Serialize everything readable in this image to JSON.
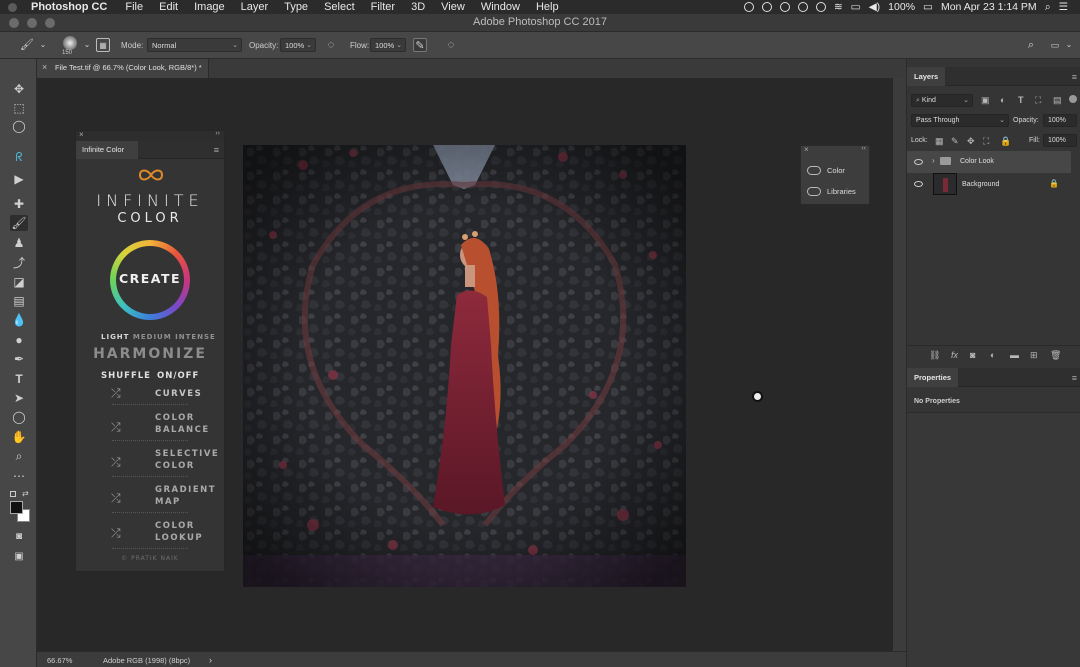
{
  "menubar": {
    "app_name": "Photoshop CC",
    "items": [
      "File",
      "Edit",
      "Image",
      "Layer",
      "Type",
      "Select",
      "Filter",
      "3D",
      "View",
      "Window",
      "Help"
    ],
    "battery": "100%",
    "clock": "Mon Apr 23  1:14 PM"
  },
  "titlebar": {
    "title": "Adobe Photoshop CC 2017"
  },
  "options": {
    "brush_size": "150",
    "mode_label": "Mode:",
    "mode_value": "Normal",
    "opacity_label": "Opacity:",
    "opacity_value": "100%",
    "flow_label": "Flow:",
    "flow_value": "100%"
  },
  "document": {
    "tab_title": "File Test.tif @ 66.7% (Color Look, RGB/8*) *",
    "zoom": "66.67%",
    "profile": "Adobe RGB (1998) (8bpc)"
  },
  "infinite_color": {
    "tab_label": "Infinite Color",
    "logo_line1": "INFINITE",
    "logo_line2": "COLOR",
    "create_label": "CREATE",
    "intensity_light": "LIGHT",
    "intensity_medium": "MEDIUM",
    "intensity_intense": "INTENSE",
    "harmonize": "HARMONIZE",
    "shuffle": "SHUFFLE",
    "onoff": "ON/OFF",
    "curves": "CURVES",
    "color_balance_1": "COLOR",
    "color_balance_2": "BALANCE",
    "selective_color_1": "SELECTIVE",
    "selective_color_2": "COLOR",
    "gradient_map_1": "GRADIENT",
    "gradient_map_2": "MAP",
    "color_lookup_1": "COLOR",
    "color_lookup_2": "LOOKUP",
    "credit": "© PRATIK NAIK"
  },
  "float_panel": {
    "color_label": "Color",
    "libraries_label": "Libraries"
  },
  "layers": {
    "tab_label": "Layers",
    "kind_label": "Kind",
    "blend_mode": "Pass Through",
    "opacity_label": "Opacity:",
    "opacity_value": "100%",
    "lock_label": "Lock:",
    "fill_label": "Fill:",
    "fill_value": "100%",
    "rows": [
      {
        "name": "Color Look"
      },
      {
        "name": "Background"
      }
    ]
  },
  "properties": {
    "tab_label": "Properties",
    "empty_text": "No Properties"
  },
  "colors": {
    "accent_red": "#c0405a",
    "panel_bg": "#343434"
  }
}
